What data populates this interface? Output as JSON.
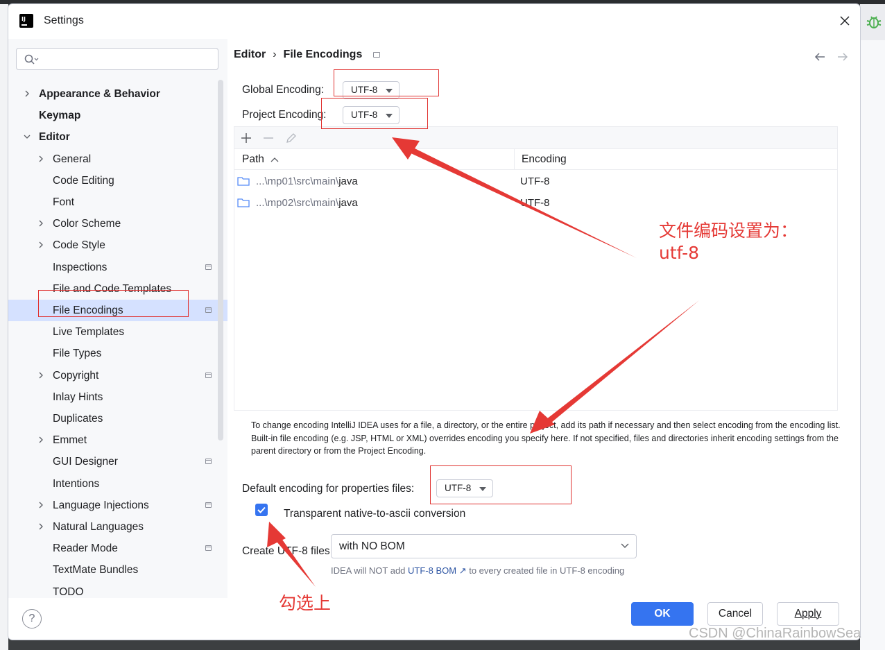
{
  "window": {
    "title": "Settings"
  },
  "search": {
    "placeholder": ""
  },
  "tree": [
    {
      "label": "Appearance & Behavior",
      "bold": true,
      "arrow": "right",
      "level": 0
    },
    {
      "label": "Keymap",
      "bold": true,
      "arrow": "none",
      "level": 0
    },
    {
      "label": "Editor",
      "bold": true,
      "arrow": "down",
      "level": 0
    },
    {
      "label": "General",
      "arrow": "right",
      "level": 1
    },
    {
      "label": "Code Editing",
      "arrow": "none",
      "level": 1
    },
    {
      "label": "Font",
      "arrow": "none",
      "level": 1
    },
    {
      "label": "Color Scheme",
      "arrow": "right",
      "level": 1
    },
    {
      "label": "Code Style",
      "arrow": "right",
      "level": 1
    },
    {
      "label": "Inspections",
      "arrow": "none",
      "level": 1,
      "mark": true
    },
    {
      "label": "File and Code Templates",
      "arrow": "none",
      "level": 1
    },
    {
      "label": "File Encodings",
      "arrow": "none",
      "level": 1,
      "mark": true,
      "selected": true
    },
    {
      "label": "Live Templates",
      "arrow": "none",
      "level": 1
    },
    {
      "label": "File Types",
      "arrow": "none",
      "level": 1
    },
    {
      "label": "Copyright",
      "arrow": "right",
      "level": 1,
      "mark": true
    },
    {
      "label": "Inlay Hints",
      "arrow": "none",
      "level": 1
    },
    {
      "label": "Duplicates",
      "arrow": "none",
      "level": 1
    },
    {
      "label": "Emmet",
      "arrow": "right",
      "level": 1
    },
    {
      "label": "GUI Designer",
      "arrow": "none",
      "level": 1,
      "mark": true
    },
    {
      "label": "Intentions",
      "arrow": "none",
      "level": 1
    },
    {
      "label": "Language Injections",
      "arrow": "right",
      "level": 1,
      "mark": true
    },
    {
      "label": "Natural Languages",
      "arrow": "right",
      "level": 1
    },
    {
      "label": "Reader Mode",
      "arrow": "none",
      "level": 1,
      "mark": true
    },
    {
      "label": "TextMate Bundles",
      "arrow": "none",
      "level": 1
    },
    {
      "label": "TODO",
      "arrow": "none",
      "level": 1
    }
  ],
  "breadcrumb": {
    "parent": "Editor",
    "sep": "›",
    "current": "File Encodings"
  },
  "global_encoding": {
    "label": "Global Encoding:",
    "value": "UTF-8"
  },
  "project_encoding": {
    "label": "Project Encoding:",
    "value": "UTF-8"
  },
  "table": {
    "columns": {
      "path": "Path",
      "encoding": "Encoding"
    },
    "rows": [
      {
        "prefix": "...\\mp01\\src\\main\\",
        "name": "java",
        "encoding": "UTF-8"
      },
      {
        "prefix": "...\\mp02\\src\\main\\",
        "name": "java",
        "encoding": "UTF-8"
      }
    ]
  },
  "note": "To change encoding IntelliJ IDEA uses for a file, a directory, or the entire project, add its path if necessary and then select encoding from the encoding list. Built-in file encoding (e.g. JSP, HTML or XML) overrides encoding you specify here. If not specified, files and directories inherit encoding settings from the parent directory or from the Project Encoding.",
  "properties_encoding": {
    "label": "Default encoding for properties files:",
    "value": "UTF-8"
  },
  "native_to_ascii": {
    "label": "Transparent native-to-ascii conversion",
    "checked": true
  },
  "create_utf8": {
    "label": "Create UTF-8 files:",
    "value": "with NO BOM"
  },
  "hint": {
    "before": "IDEA will NOT add ",
    "link": "UTF-8 BOM ↗",
    "after": " to every created file in UTF-8 encoding"
  },
  "buttons": {
    "ok": "OK",
    "cancel": "Cancel",
    "apply": "Apply",
    "help": "?"
  },
  "annotations": {
    "file_encoding_note_line1": "文件编码设置为：",
    "file_encoding_note_line2": "utf-8",
    "check_note": "勾选上",
    "arrow_color": "#e53935"
  },
  "watermark": "CSDN @ChinaRainbowSea",
  "colors": {
    "accent": "#3574f0",
    "selection": "#d5e1ff",
    "annotation": "#e0312f"
  }
}
